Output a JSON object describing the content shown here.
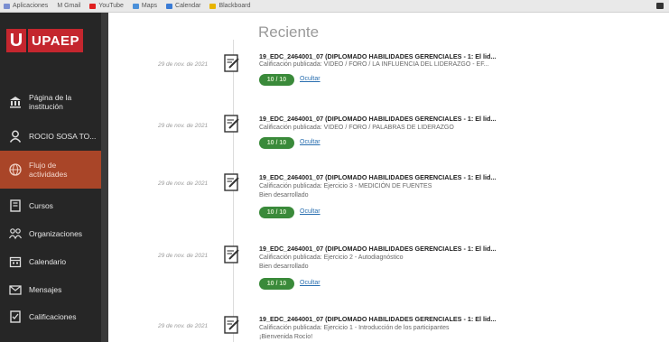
{
  "bookmarks": [
    {
      "label": "Aplicaciones",
      "color": "#7b8fd1"
    },
    {
      "label": "M Gmail",
      "color": "#d44638"
    },
    {
      "label": "YouTube",
      "color": "#e02020"
    },
    {
      "label": "Maps",
      "color": "#4a90d9"
    },
    {
      "label": "Calendar",
      "color": "#3a7bd5"
    },
    {
      "label": "Blackboard",
      "color": "#e8b400"
    }
  ],
  "brand": {
    "letter": "U",
    "name": "UPAEP",
    "color": "#c4262e"
  },
  "sidebar": {
    "items": [
      {
        "label": "Página de la institución",
        "icon": "institution-icon"
      },
      {
        "label": "ROCIO SOSA TO...",
        "icon": "user-icon"
      },
      {
        "label": "Flujo de actividades",
        "icon": "globe-icon",
        "active": true
      },
      {
        "label": "Cursos",
        "icon": "courses-icon"
      },
      {
        "label": "Organizaciones",
        "icon": "organizations-icon"
      },
      {
        "label": "Calendario",
        "icon": "calendar-icon"
      },
      {
        "label": "Mensajes",
        "icon": "messages-icon"
      },
      {
        "label": "Calificaciones",
        "icon": "grades-icon"
      }
    ]
  },
  "main": {
    "heading": "Reciente",
    "entries": [
      {
        "date": "29 de nov. de 2021",
        "title": "19_EDC_2464001_07 (DIPLOMADO HABILIDADES GERENCIALES - 1: El lid...",
        "subtitle": "Calificación publicada: VIDEO / FORO / LA INFLUENCIA DEL LIDERAZGO - EF...",
        "note": "",
        "grade": "10 / 10",
        "hide_label": "Ocultar"
      },
      {
        "date": "29 de nov. de 2021",
        "title": "19_EDC_2464001_07 (DIPLOMADO HABILIDADES GERENCIALES - 1: El lid...",
        "subtitle": "Calificación publicada: VIDEO / FORO / PALABRAS DE LIDERAZGO",
        "note": "",
        "grade": "10 / 10",
        "hide_label": "Ocultar"
      },
      {
        "date": "29 de nov. de 2021",
        "title": "19_EDC_2464001_07 (DIPLOMADO HABILIDADES GERENCIALES - 1: El lid...",
        "subtitle": "Calificación publicada: Ejercicio 3 - MEDICIÓN DE FUENTES",
        "note": "Bien desarrollado",
        "grade": "10 / 10",
        "hide_label": "Ocultar"
      },
      {
        "date": "29 de nov. de 2021",
        "title": "19_EDC_2464001_07 (DIPLOMADO HABILIDADES GERENCIALES - 1: El lid...",
        "subtitle": "Calificación publicada: Ejercicio 2 - Autodiagnóstico",
        "note": "Bien desarrollado",
        "grade": "10 / 10",
        "hide_label": "Ocultar"
      },
      {
        "date": "29 de nov. de 2021",
        "title": "19_EDC_2464001_07 (DIPLOMADO HABILIDADES GERENCIALES - 1: El lid...",
        "subtitle": "Calificación publicada: Ejercicio 1 - Introducción de los participantes",
        "note": "¡Bienvenida Rocío!",
        "grade": "",
        "hide_label": ""
      }
    ]
  }
}
